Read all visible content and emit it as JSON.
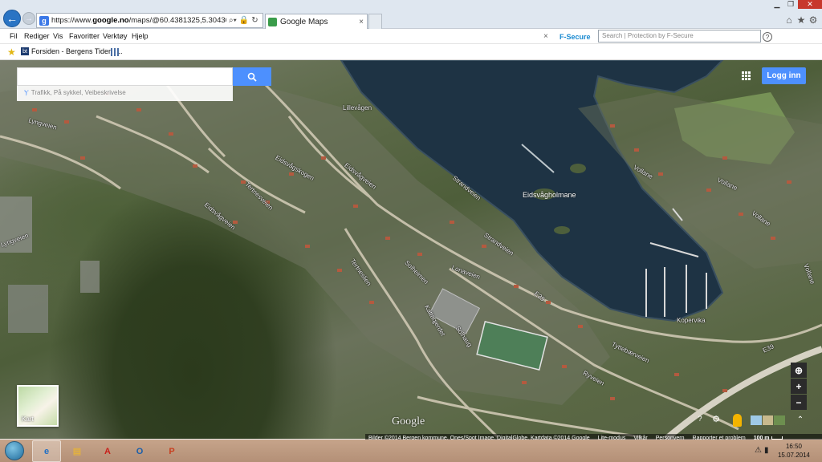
{
  "browser": {
    "url_prefix": "https://www.google.no",
    "url_rest": "/maps/@60.4381325,5.304363,833m/data",
    "url_display_prefix": "https://www.",
    "url_domain": "google.no",
    "url_path": "/maps/@60.4381325,5.304363,833m/data‹",
    "tab_title": "Google Maps",
    "tab_close": "×"
  },
  "menu": {
    "items": [
      "Fil",
      "Rediger",
      "Vis",
      "Favoritter",
      "Verktøy",
      "Hjelp"
    ],
    "fsecure_close": "×",
    "fsecure_brand": "F-Secure",
    "fsecure_search_placeholder": "Search | Protection by F-Secure",
    "help": "?"
  },
  "favorites": {
    "link_label": "Forsiden - Bergens Tidend...",
    "link_badge": "bt"
  },
  "map": {
    "search_placeholder": "",
    "suggest_text": "Trafikk, På sykkel, Veibeskrivelse",
    "login_label": "Logg inn",
    "minimap_label": "Kart",
    "zoom_in": "+",
    "zoom_out": "−",
    "compass": "⊕",
    "watermark": "Google",
    "help": "?",
    "gear": "⚙",
    "layers_toggle": "⌃",
    "attribution": "Bilder ©2014 Bergen kommune, Ones/Spot Image, DigitalGlobe, Kartdata ©2014 Google",
    "links": [
      "Lite-modus",
      "Vilkår",
      "Personvern",
      "Rapporter et problem"
    ],
    "scale_label": "100 m",
    "labels": [
      {
        "text": "Lillevågen"
      },
      {
        "text": "Eidsvågholmane"
      },
      {
        "text": "Kopervika"
      },
      {
        "text": "Eidsvågveien"
      },
      {
        "text": "Eidsvågskogen"
      },
      {
        "text": "Eidsvågveien"
      },
      {
        "text": "Strandveien"
      },
      {
        "text": "Strandveien"
      },
      {
        "text": "Solheimen"
      },
      {
        "text": "Tertnesveien"
      },
      {
        "text": "Lyngveien"
      },
      {
        "text": "Vollane"
      },
      {
        "text": "Vollane"
      },
      {
        "text": "Vollane"
      },
      {
        "text": "Vollane"
      },
      {
        "text": "Tyttebærveien"
      },
      {
        "text": "Tertneslien"
      },
      {
        "text": "Kattaqjerdet"
      },
      {
        "text": "Lonaveien"
      },
      {
        "text": "Solhaug"
      },
      {
        "text": "Lyngveien"
      },
      {
        "text": "E39"
      },
      {
        "text": "E39"
      },
      {
        "text": "Ryveien"
      }
    ]
  },
  "taskbar": {
    "apps": [
      "e",
      "▤",
      "A",
      "O",
      "P"
    ],
    "time": "16:50",
    "date": "15.07.2014"
  }
}
